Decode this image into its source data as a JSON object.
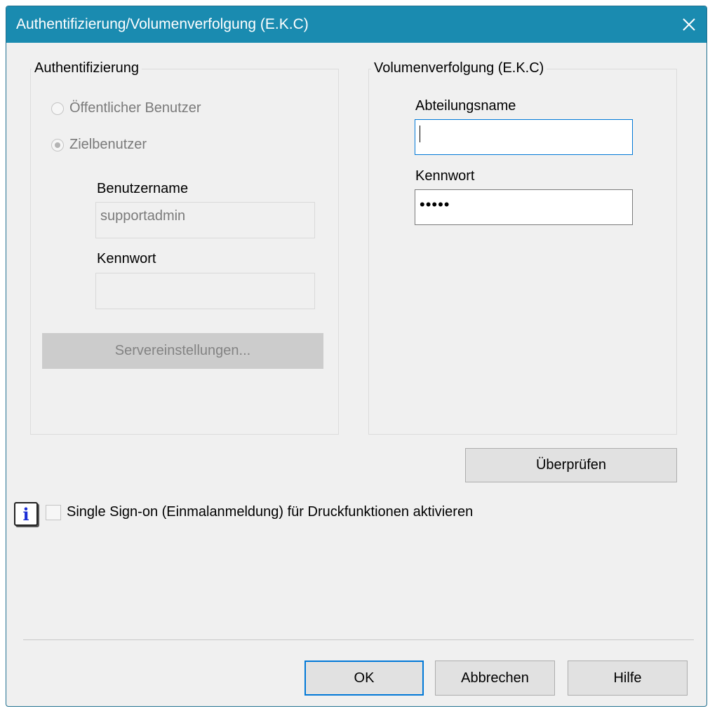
{
  "window": {
    "title": "Authentifizierung/Volumenverfolgung (E.K.C)"
  },
  "auth": {
    "group_title": "Authentifizierung",
    "radio_public": "Öffentlicher Benutzer",
    "radio_target": "Zielbenutzer",
    "selected": "Zielbenutzer",
    "username_label": "Benutzername",
    "username_value": "supportadmin",
    "password_label": "Kennwort",
    "password_value": "",
    "server_settings_button": "Servereinstellungen..."
  },
  "volume": {
    "group_title": "Volumenverfolgung (E.K.C)",
    "department_label": "Abteilungsname",
    "department_value": "",
    "password_label": "Kennwort",
    "password_value": "•••••",
    "verify_button": "Überprüfen"
  },
  "sso": {
    "label": "Single Sign-on (Einmalanmeldung) für Druckfunktionen aktivieren",
    "checked": false,
    "info_icon": "i"
  },
  "footer": {
    "ok": "OK",
    "cancel": "Abbrechen",
    "help": "Hilfe"
  },
  "colors": {
    "titlebar": "#1a8bb0",
    "focus": "#0078d7",
    "info": "#1a2dd6"
  }
}
